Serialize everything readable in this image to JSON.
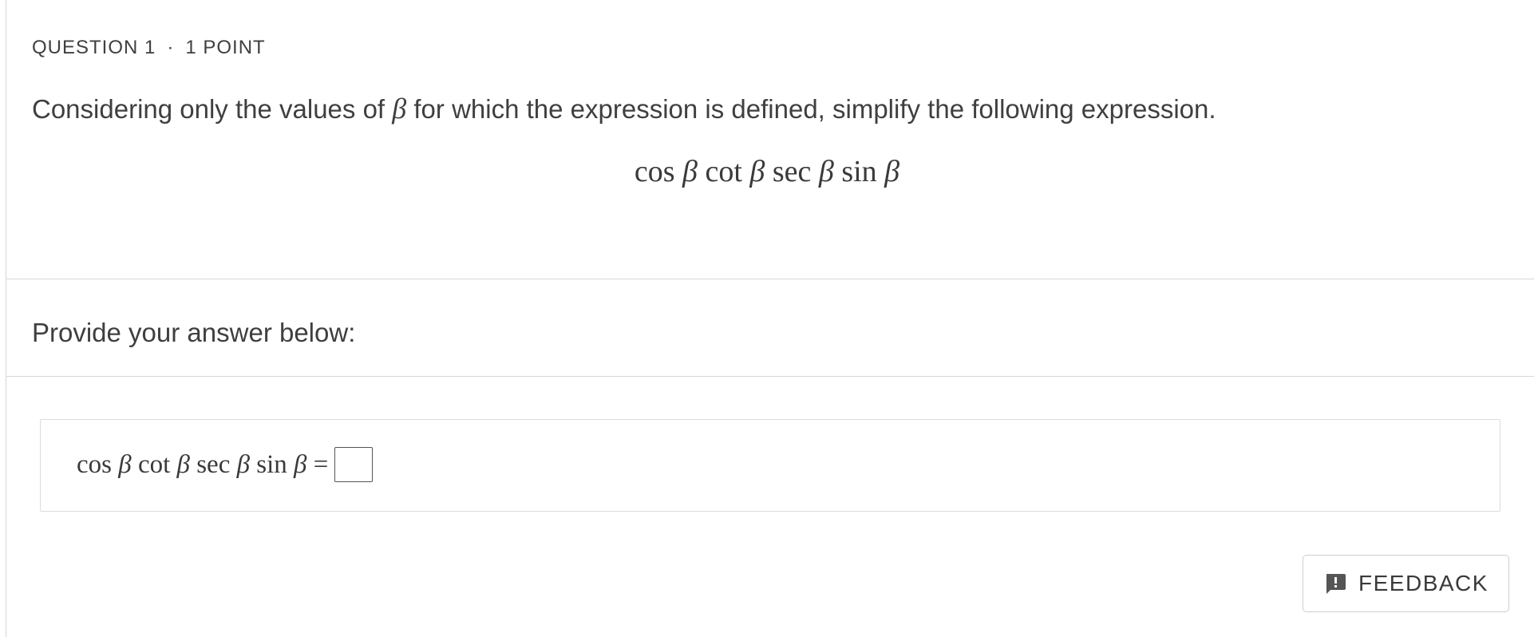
{
  "question": {
    "number_label": "QUESTION 1",
    "separator": "·",
    "points_label": "1 POINT",
    "prompt_before": "Considering only the values of ",
    "prompt_variable": "β",
    "prompt_after": " for which the expression is defined, simplify the following expression."
  },
  "expression": {
    "f1": "cos",
    "v1": "β",
    "f2": "cot",
    "v2": "β",
    "f3": "sec",
    "v3": "β",
    "f4": "sin",
    "v4": "β"
  },
  "answer": {
    "label": "Provide your answer below:",
    "equals": "=",
    "input_value": ""
  },
  "feedback": {
    "label": "FEEDBACK",
    "icon": "feedback-icon"
  }
}
